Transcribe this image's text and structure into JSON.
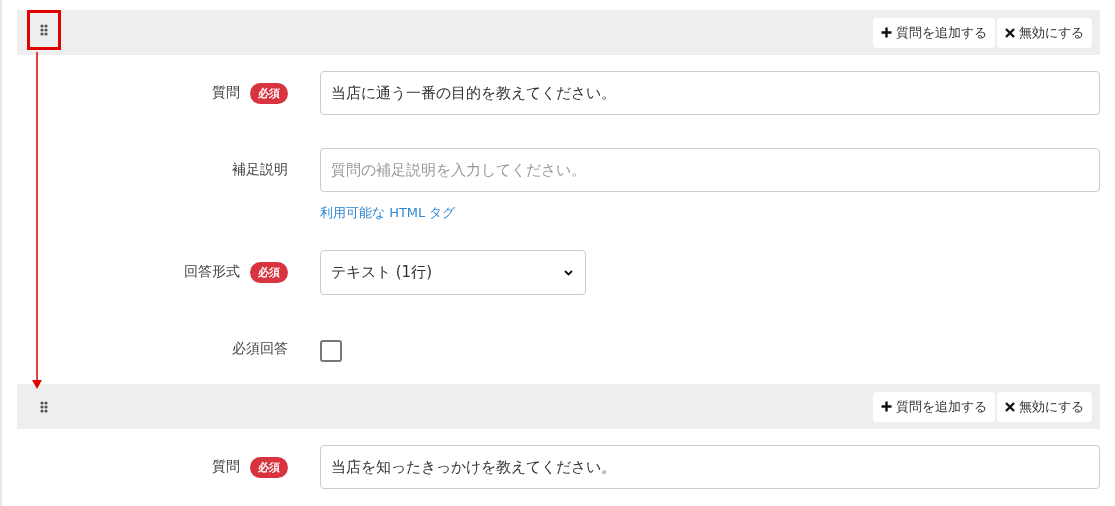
{
  "blocks": [
    {
      "highlighted": true,
      "buttons": [
        {
          "kind": "add",
          "label": "質問を追加する"
        },
        {
          "kind": "disable",
          "label": "無効にする"
        }
      ],
      "fields": [
        {
          "kind": "text",
          "label": "質問",
          "required_badge": "必須",
          "value": "当店に通う一番の目的を教えてください。"
        },
        {
          "kind": "textarea",
          "label": "補足説明",
          "placeholder": "質問の補足説明を入力してください。",
          "link": "利用可能な HTML タグ"
        },
        {
          "kind": "select",
          "label": "回答形式",
          "required_badge": "必須",
          "value": "テキスト (1行)"
        },
        {
          "kind": "checkbox",
          "label": "必須回答",
          "checked": false
        }
      ]
    },
    {
      "highlighted": false,
      "buttons": [
        {
          "kind": "add",
          "label": "質問を追加する"
        },
        {
          "kind": "disable",
          "label": "無効にする"
        }
      ],
      "fields": [
        {
          "kind": "text",
          "label": "質問",
          "required_badge": "必須",
          "value": "当店を知ったきっかけを教えてください。"
        }
      ]
    }
  ]
}
